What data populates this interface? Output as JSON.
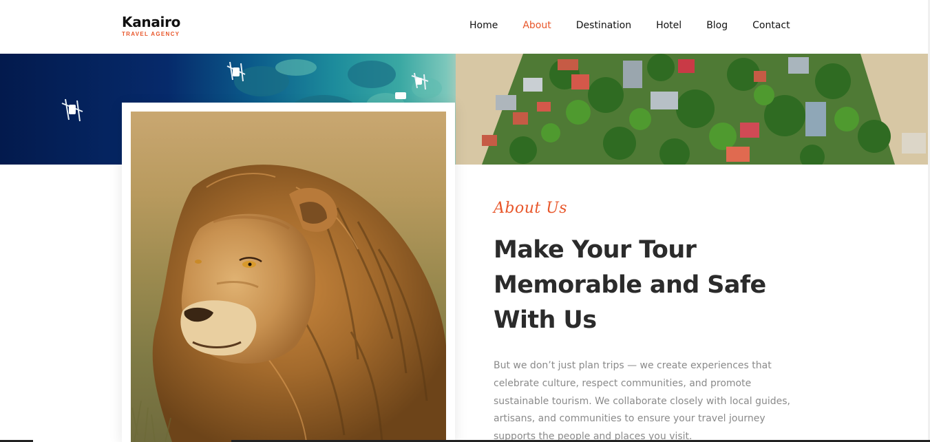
{
  "brand": {
    "name": "Kanairo",
    "tagline": "TRAVEL AGENCY"
  },
  "nav": {
    "items": [
      {
        "label": "Home",
        "active": false
      },
      {
        "label": "About",
        "active": true
      },
      {
        "label": "Destination",
        "active": false
      },
      {
        "label": "Hotel",
        "active": false
      },
      {
        "label": "Blog",
        "active": false
      },
      {
        "label": "Contact",
        "active": false
      }
    ]
  },
  "colors": {
    "accent": "#e8562a",
    "heading": "#2b2b2b",
    "body_text": "#8a8a8a"
  },
  "hero": {
    "image": "aerial-coastline-village"
  },
  "about": {
    "image": "lion-portrait",
    "eyebrow": "About Us",
    "heading": "Make Your Tour Memorable and Safe With Us",
    "description": "But we don’t just plan trips — we create experiences that celebrate culture, respect communities, and promote sustainable tourism. We collaborate closely with local guides, artisans, and communities to ensure your travel journey supports the people and places you visit."
  }
}
